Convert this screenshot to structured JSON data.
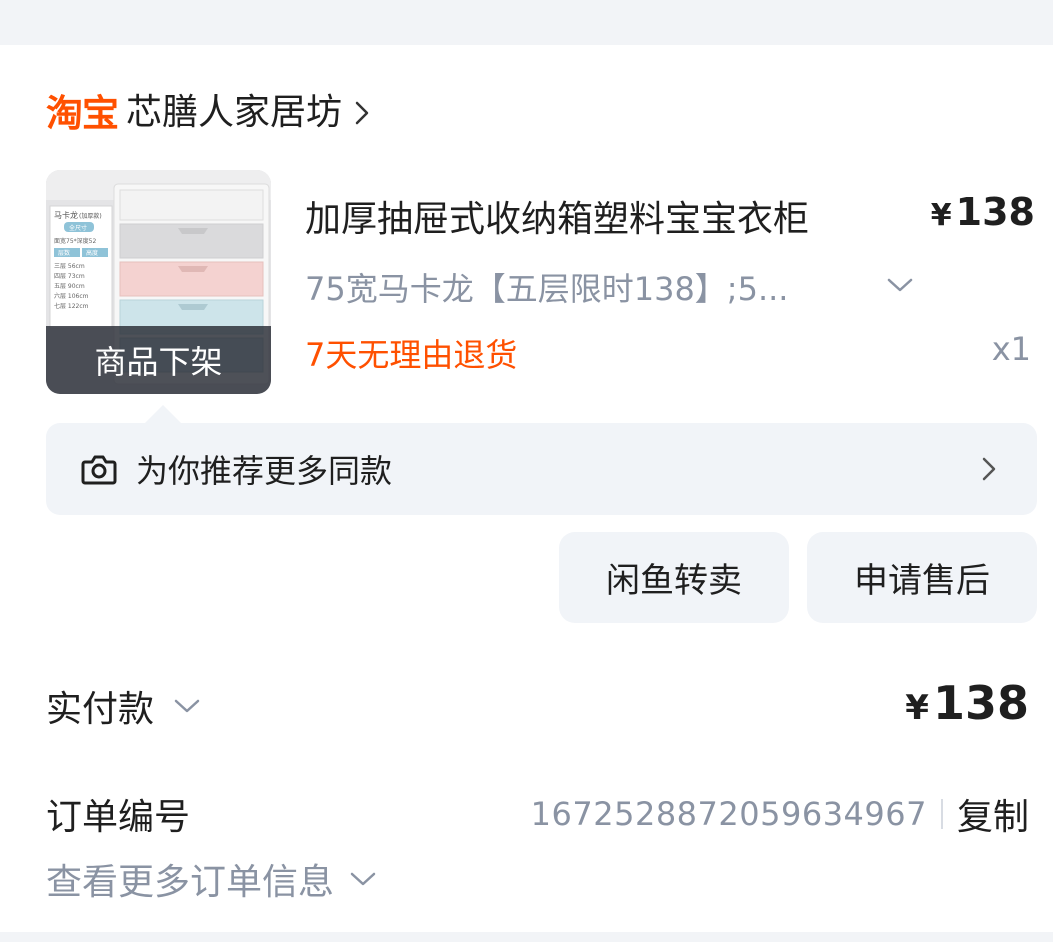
{
  "shop": {
    "platform_logo": "淘宝",
    "name": "芯膳人家居坊",
    "chevron_icon": "chevron-right-icon"
  },
  "product": {
    "thumbnail_status": "商品下架",
    "thumbnail_text": {
      "brand": "马卡龙",
      "brand_sub": "(加厚款)",
      "tag": "全尺寸",
      "size_note": "面宽75*深度52",
      "header_left": "层数",
      "header_right": "高度",
      "rows": [
        "三层 56cm",
        "四层 73cm",
        "五层 90cm",
        "六层 106cm",
        "七层 122cm"
      ]
    },
    "title": "加厚抽屉式收纳箱塑料宝宝衣柜",
    "currency": "¥",
    "price": "138",
    "spec": "75宽马卡龙【五层限时138】;5...",
    "return_policy": "7天无理由退货",
    "quantity": "x1"
  },
  "recommendation": {
    "icon": "camera-icon",
    "text": "为你推荐更多同款"
  },
  "actions": {
    "resell_label": "闲鱼转卖",
    "after_sale_label": "申请售后"
  },
  "payment": {
    "label": "实付款",
    "currency": "¥",
    "amount": "138"
  },
  "order": {
    "label": "订单编号",
    "number": "1672528872059634967",
    "copy_label": "复制",
    "more_label": "查看更多订单信息"
  },
  "colors": {
    "brand_orange": "#ff5000",
    "muted_text": "#8a93a3",
    "panel_bg": "#f1f4f8"
  }
}
